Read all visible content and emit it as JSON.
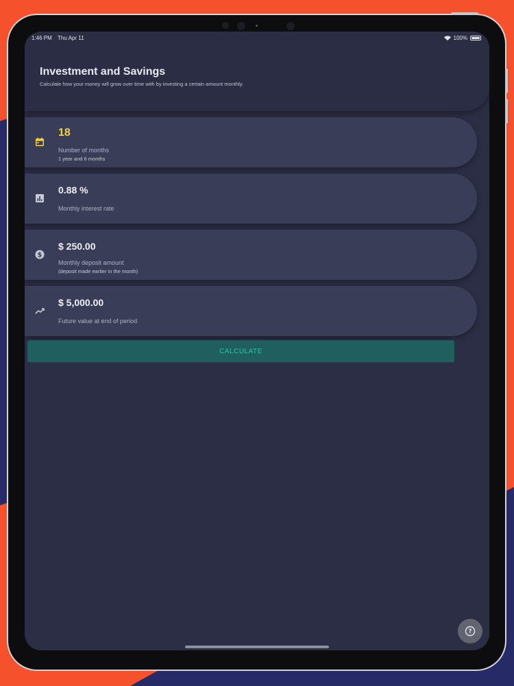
{
  "statusbar": {
    "time": "1:46 PM",
    "date": "Thu Apr 11",
    "battery": "100%"
  },
  "header": {
    "title": "Investment and Savings",
    "subtitle": "Calculate how your money will grow over time with by investing a certain amount monthly."
  },
  "fields": [
    {
      "icon": "calendar-icon",
      "value": "18",
      "label": "Number of months",
      "hint": "1 year and 6 months",
      "color": "#f5d13c"
    },
    {
      "icon": "bar-chart-icon",
      "value": "0.88 %",
      "label": "Monthly interest rate",
      "hint": ""
    },
    {
      "icon": "dollar-circle-icon",
      "value": "$ 250.00",
      "label": "Monthly deposit amount",
      "hint": "(deposit made earlier in the month)"
    },
    {
      "icon": "trending-up-icon",
      "value": "$ 5,000.00",
      "label": "Future value at end of period",
      "hint": ""
    }
  ],
  "calculate_label": "CALCULATE",
  "help_icon": "help-circle-icon",
  "colors": {
    "accent": "#2ec4a8",
    "button": "#1f5f60",
    "card": "#3a3d58",
    "screen": "#2c2e46"
  }
}
